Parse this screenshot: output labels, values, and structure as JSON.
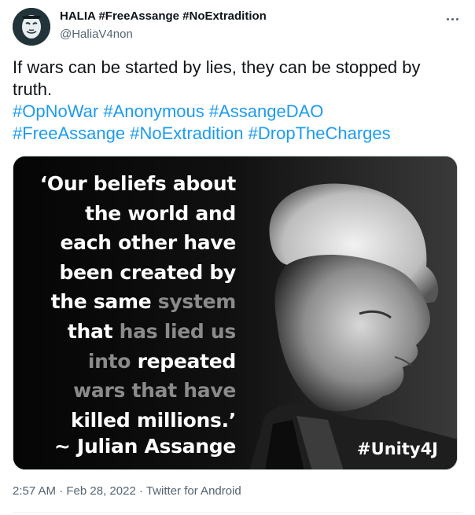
{
  "tweet": {
    "display_name": "HALIA #FreeAssange #NoExtradition",
    "handle": "@HaliaV4non",
    "text": "If wars can be started by lies, they can be stopped by truth.",
    "hashtag_lines": [
      [
        "#OpNoWar",
        "#Anonymous",
        "#AssangeDAO"
      ],
      [
        "#FreeAssange",
        "#NoExtradition",
        "#DropTheCharges"
      ]
    ],
    "image": {
      "quote_lines": [
        {
          "parts": [
            {
              "t": "‘Our beliefs about",
              "dim": false
            }
          ]
        },
        {
          "parts": [
            {
              "t": "the world and",
              "dim": false
            }
          ]
        },
        {
          "parts": [
            {
              "t": "each other have",
              "dim": false
            }
          ]
        },
        {
          "parts": [
            {
              "t": "been created by",
              "dim": false
            }
          ]
        },
        {
          "parts": [
            {
              "t": "the same ",
              "dim": false
            },
            {
              "t": "system",
              "dim": true
            }
          ]
        },
        {
          "parts": [
            {
              "t": "that ",
              "dim": false
            },
            {
              "t": "has lied us",
              "dim": true
            }
          ]
        },
        {
          "parts": [
            {
              "t": "into ",
              "dim": true
            },
            {
              "t": "repeated",
              "dim": false
            }
          ]
        },
        {
          "parts": [
            {
              "t": "wars that have",
              "dim": true
            }
          ]
        },
        {
          "parts": [
            {
              "t": "killed millions.’",
              "dim": false
            }
          ]
        }
      ],
      "author": "~ Julian Assange",
      "tag": "#Unity4J"
    },
    "time": "2:57 AM",
    "date": "Feb 28, 2022",
    "separator": "·",
    "client": "Twitter for Android",
    "colors": {
      "link": "#1d9bf0",
      "secondary": "#536471",
      "text": "#0f1419"
    }
  }
}
